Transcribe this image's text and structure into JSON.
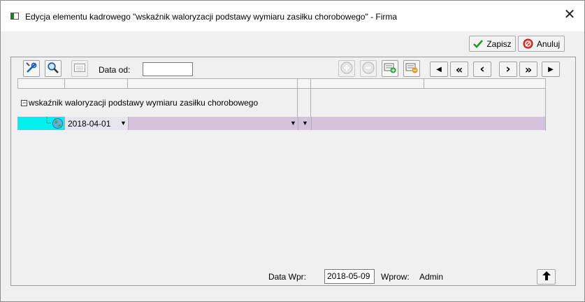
{
  "window": {
    "title": "Edycja elementu kadrowego \"wskaźnik waloryzacji podstawy wymiaru zasiłku chorobowego\" - Firma",
    "close_glyph": "✕"
  },
  "actions": {
    "save_label": "Zapisz",
    "cancel_label": "Anuluj"
  },
  "toolbar": {
    "tools_icon": "tools-icon",
    "search_icon": "magnifier-icon",
    "calendar_icon": "calendar-icon",
    "date_from_label": "Data od:",
    "date_from_value": "",
    "add_icon": "plus-circle-icon",
    "remove_icon": "minus-circle-icon",
    "add_record_icon": "add-record-icon",
    "edit_record_icon": "edit-record-icon",
    "nav": {
      "first": "◀",
      "prev_fast": "«",
      "prev": "‹",
      "next": "›",
      "next_fast": "»",
      "last": "▶"
    }
  },
  "grid": {
    "group_label": "wskaźnik waloryzacji podstawy wymiaru zasiłku chorobowego",
    "collapse_glyph": "−",
    "row": {
      "date": "2018-04-01",
      "value": "",
      "extra": "",
      "dropdown_glyph": "▼"
    }
  },
  "footer": {
    "entry_date_label": "Data Wpr:",
    "entry_date_value": "2018-05-09",
    "entered_by_label": "Wprow:",
    "entered_by_value": "Admin",
    "up_glyph": "🡅"
  },
  "colors": {
    "accent_cyan": "#00f0f0",
    "row_purple": "#d5c3dd",
    "save_check": "#1a9a2a",
    "cancel_red": "#d22a2a"
  }
}
